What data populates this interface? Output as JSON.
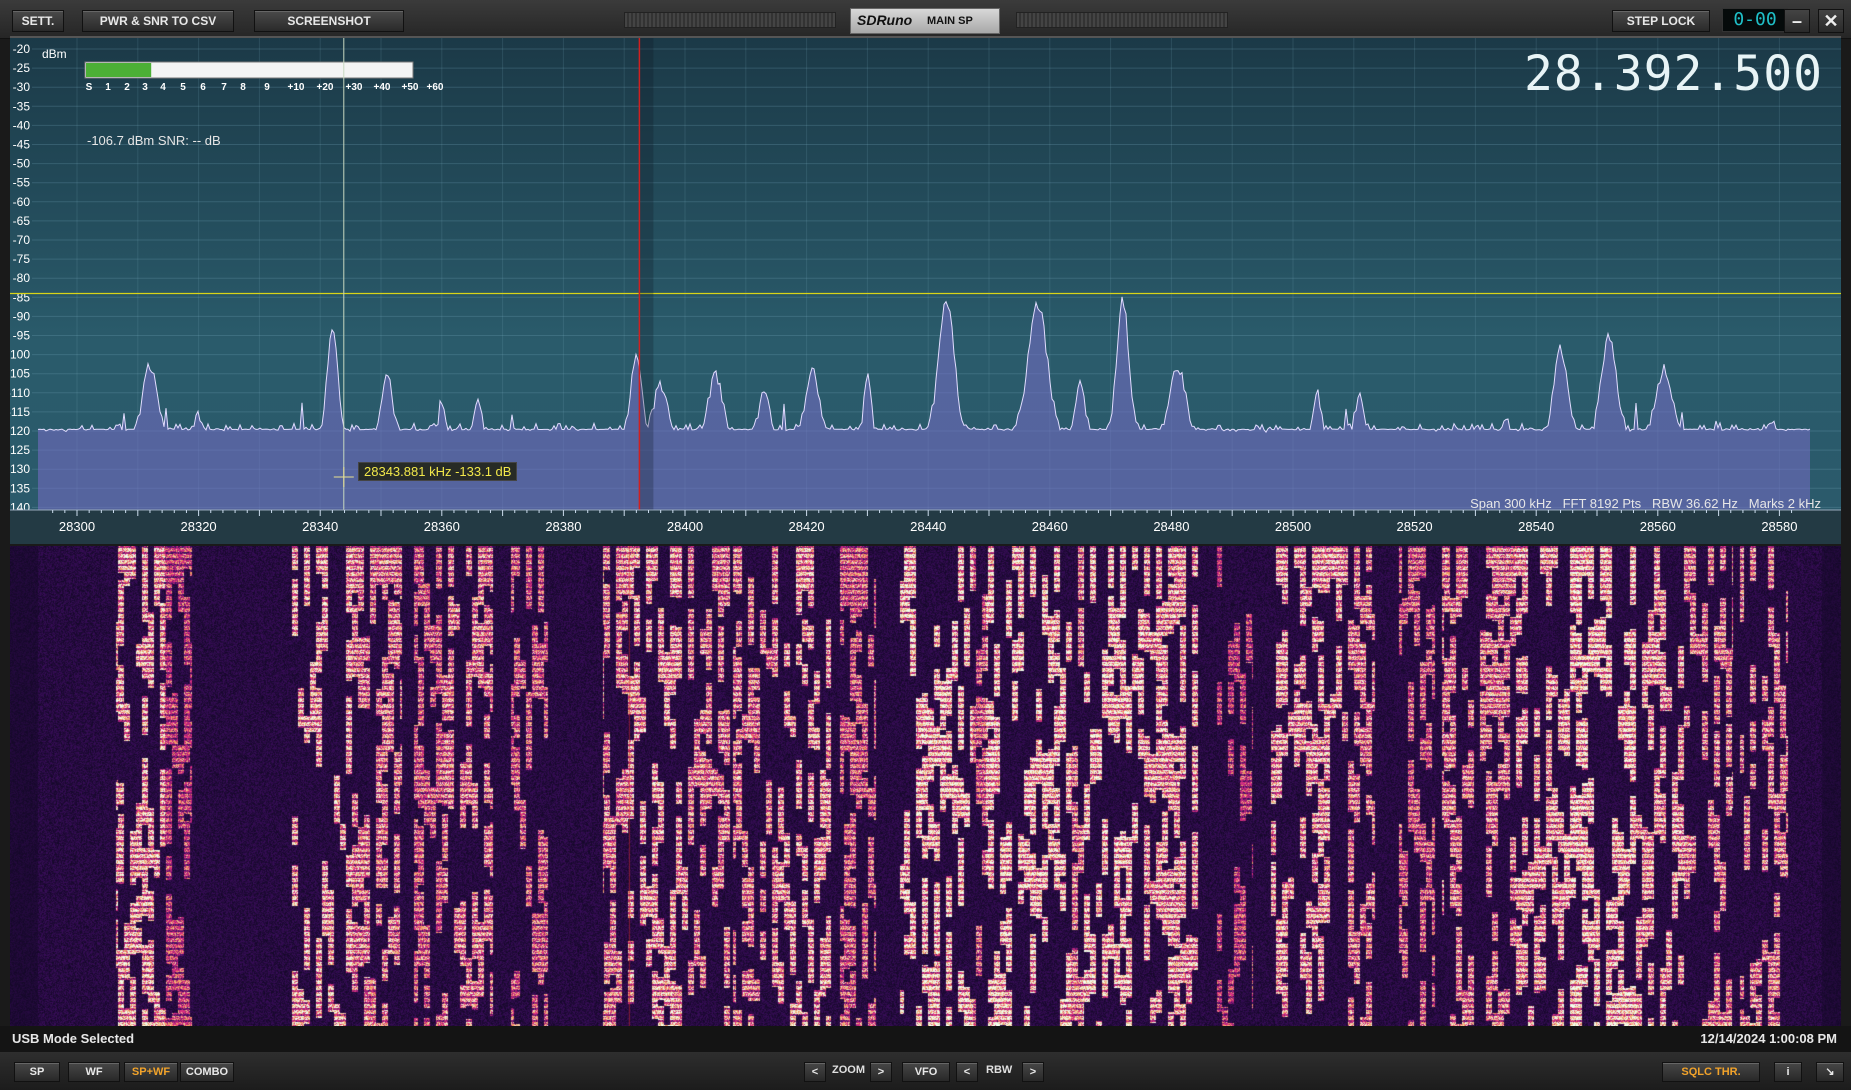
{
  "toolbar": {
    "settings": "SETT.",
    "export": "PWR & SNR TO CSV",
    "screenshot": "SCREENSHOT",
    "step_lock": "STEP LOCK",
    "clock": "0-00",
    "minimize_icon": "minimize-icon",
    "close_icon": "close-icon"
  },
  "title": {
    "app": "SDRuno",
    "panel": "MAIN SP"
  },
  "spectrum": {
    "units": "dBm",
    "y_ticks": [
      "-20",
      "-25",
      "-30",
      "-35",
      "-40",
      "-45",
      "-50",
      "-55",
      "-60",
      "-65",
      "-70",
      "-75",
      "-80",
      "-85",
      "-90",
      "-95",
      "-100",
      "-105",
      "-110",
      "-115",
      "-120",
      "-125",
      "-130",
      "-135",
      "-140"
    ],
    "x_ticks": [
      "28300",
      "28320",
      "28340",
      "28360",
      "28380",
      "28400",
      "28420",
      "28440",
      "28460",
      "28480",
      "28500",
      "28520",
      "28540",
      "28560",
      "28580"
    ],
    "s_meter_labels": [
      "S",
      "1",
      "2",
      "3",
      "4",
      "5",
      "6",
      "7",
      "8",
      "9",
      "+10",
      "+20",
      "+30",
      "+40",
      "+50",
      "+60"
    ],
    "s_meter_fill": 0.2,
    "level_readout": "-106.7 dBm   SNR: -- dB",
    "frequency": "28392500",
    "frequency_display": "28.392.500",
    "stats": "Span 300 kHz   FFT 8192 Pts   RBW 36.62 Hz   Marks 2 kHz",
    "cursor_tip": "28343.881 kHz -133.1 dB",
    "squelch_level_dbm": -84,
    "vfo_khz": 28392.5,
    "cursor_khz": 28343.881
  },
  "status": {
    "mode": "USB Mode Selected",
    "datetime": "12/14/2024 1:00:08 PM"
  },
  "bottom": {
    "sp": "SP",
    "wf": "WF",
    "spwf": "SP+WF",
    "combo": "COMBO",
    "zoom": "ZOOM",
    "vfo": "VFO",
    "rbw": "RBW",
    "sqlc": "SQLC THR.",
    "info": "i",
    "prev": "<",
    "next": ">"
  }
}
